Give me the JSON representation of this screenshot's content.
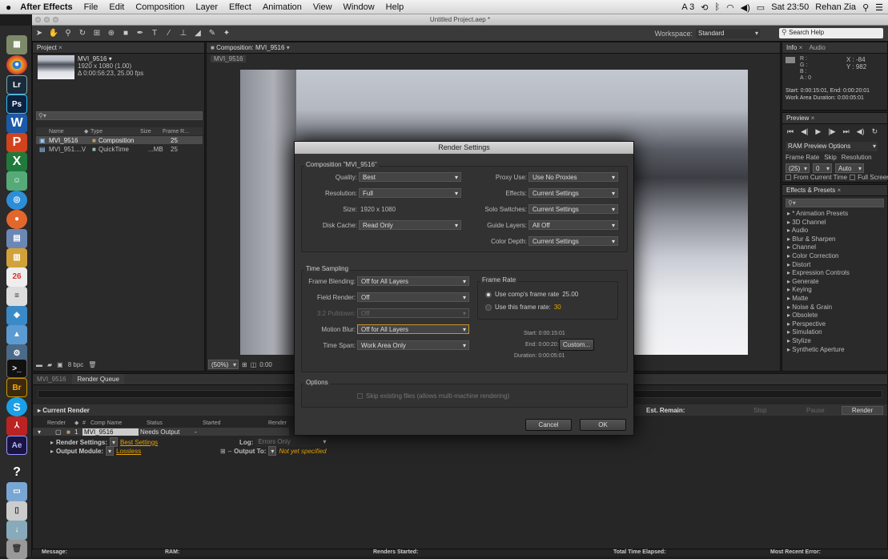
{
  "menubar": {
    "app": "After Effects",
    "items": [
      "File",
      "Edit",
      "Composition",
      "Layer",
      "Effect",
      "Animation",
      "View",
      "Window",
      "Help"
    ],
    "status": "A 3",
    "clock": "Sat 23:50",
    "user": "Rehan Zia"
  },
  "window": {
    "title": "Untitled Project.aep *"
  },
  "toolbar": {
    "workspace_label": "Workspace:",
    "workspace_value": "Standard",
    "search_placeholder": "Search Help"
  },
  "project": {
    "tab": "Project",
    "item_name": "MVI_9516 ▾",
    "item_size": "1920 x 1080 (1.00)",
    "item_duration": "Δ 0:00:56:23, 25.00 fps",
    "columns": [
      "Name",
      "Type",
      "Size",
      "Frame R..."
    ],
    "rows": [
      {
        "name": "MVI_9516",
        "type": "Composition",
        "size": "",
        "rate": "25"
      },
      {
        "name": "MVI_951....V",
        "type": "QuickTime",
        "size": "...MB",
        "rate": "25"
      }
    ],
    "bpc": "8 bpc"
  },
  "composition": {
    "tab": "Composition: MVI_9516",
    "subtab": "MVI_9516",
    "zoom": "(50%)",
    "time": "0:00"
  },
  "info": {
    "tab": "Info",
    "tab2": "Audio",
    "r": "R :",
    "g": "G :",
    "b": "B :",
    "a": "A : 0",
    "x": "X : -84",
    "y": "Y : 982",
    "line1": "Start: 0:00:15:01, End: 0:00:20:01",
    "line2": "Work Area Duration: 0:00:05:01"
  },
  "preview": {
    "tab": "Preview",
    "ram": "RAM Preview Options",
    "fr_label": "Frame Rate",
    "skip_label": "Skip",
    "res_label": "Resolution",
    "fr_val": "(25)",
    "skip_val": "0",
    "res_val": "Auto",
    "from_current": "From Current Time",
    "full_screen": "Full Screen"
  },
  "effects": {
    "tab": "Effects & Presets",
    "items": [
      "* Animation Presets",
      "3D Channel",
      "Audio",
      "Blur & Sharpen",
      "Channel",
      "Color Correction",
      "Distort",
      "Expression Controls",
      "Generate",
      "Keying",
      "Matte",
      "Noise & Grain",
      "Obsolete",
      "Perspective",
      "Simulation",
      "Stylize",
      "Synthetic Aperture"
    ]
  },
  "queue": {
    "tab1": "MVI_9516",
    "tab2": "Render Queue",
    "current_render": "Current Render",
    "est_remain": "Est. Remain:",
    "stop": "Stop",
    "pause": "Pause",
    "render": "Render",
    "columns": [
      "Render",
      "#",
      "Comp Name",
      "Status",
      "Started",
      "Render"
    ],
    "row": {
      "num": "1",
      "comp": "MVI_9516",
      "status": "Needs Output",
      "started": "-"
    },
    "render_settings_label": "Render Settings:",
    "render_settings_value": "Best Settings",
    "log_label": "Log:",
    "log_value": "Errors Only",
    "output_module_label": "Output Module:",
    "output_module_value": "Lossless",
    "output_to_label": "Output To:",
    "output_to_value": "Not yet specified"
  },
  "status": {
    "message": "Message:",
    "ram": "RAM:",
    "renders_started": "Renders Started:",
    "total_time": "Total Time Elapsed:",
    "recent_error": "Most Recent Error:"
  },
  "dialog": {
    "title": "Render Settings",
    "comp_group": "Composition \"MVI_9516\"",
    "quality_label": "Quality:",
    "quality": "Best",
    "resolution_label": "Resolution:",
    "resolution": "Full",
    "size_label": "Size:",
    "size": "1920 x 1080",
    "disk_cache_label": "Disk Cache:",
    "disk_cache": "Read Only",
    "proxy_label": "Proxy Use:",
    "proxy": "Use No Proxies",
    "effects_label": "Effects:",
    "effects": "Current Settings",
    "solo_label": "Solo Switches:",
    "solo": "Current Settings",
    "guide_label": "Guide Layers:",
    "guide": "All Off",
    "color_depth_label": "Color Depth:",
    "color_depth": "Current Settings",
    "time_group": "Time Sampling",
    "frame_blending_label": "Frame Blending:",
    "frame_blending": "Off for All Layers",
    "field_render_label": "Field Render:",
    "field_render": "Off",
    "pulldown_label": "3:2 Pulldown:",
    "pulldown": "Off",
    "motion_blur_label": "Motion Blur:",
    "motion_blur": "Off for All Layers",
    "time_span_label": "Time Span:",
    "time_span": "Work Area Only",
    "frame_rate_group": "Frame Rate",
    "use_comp_rate": "Use comp's frame rate",
    "comp_rate": "25.00",
    "use_this_rate": "Use this frame rate:",
    "this_rate": "30",
    "start": "Start: 0:00:15:01",
    "end": "End: 0:00:20:01",
    "custom": "Custom...",
    "duration": "Duration: 0:00:05:01",
    "options_group": "Options",
    "skip_existing": "Skip existing files (allows multi-machine rendering)",
    "cancel": "Cancel",
    "ok": "OK"
  }
}
